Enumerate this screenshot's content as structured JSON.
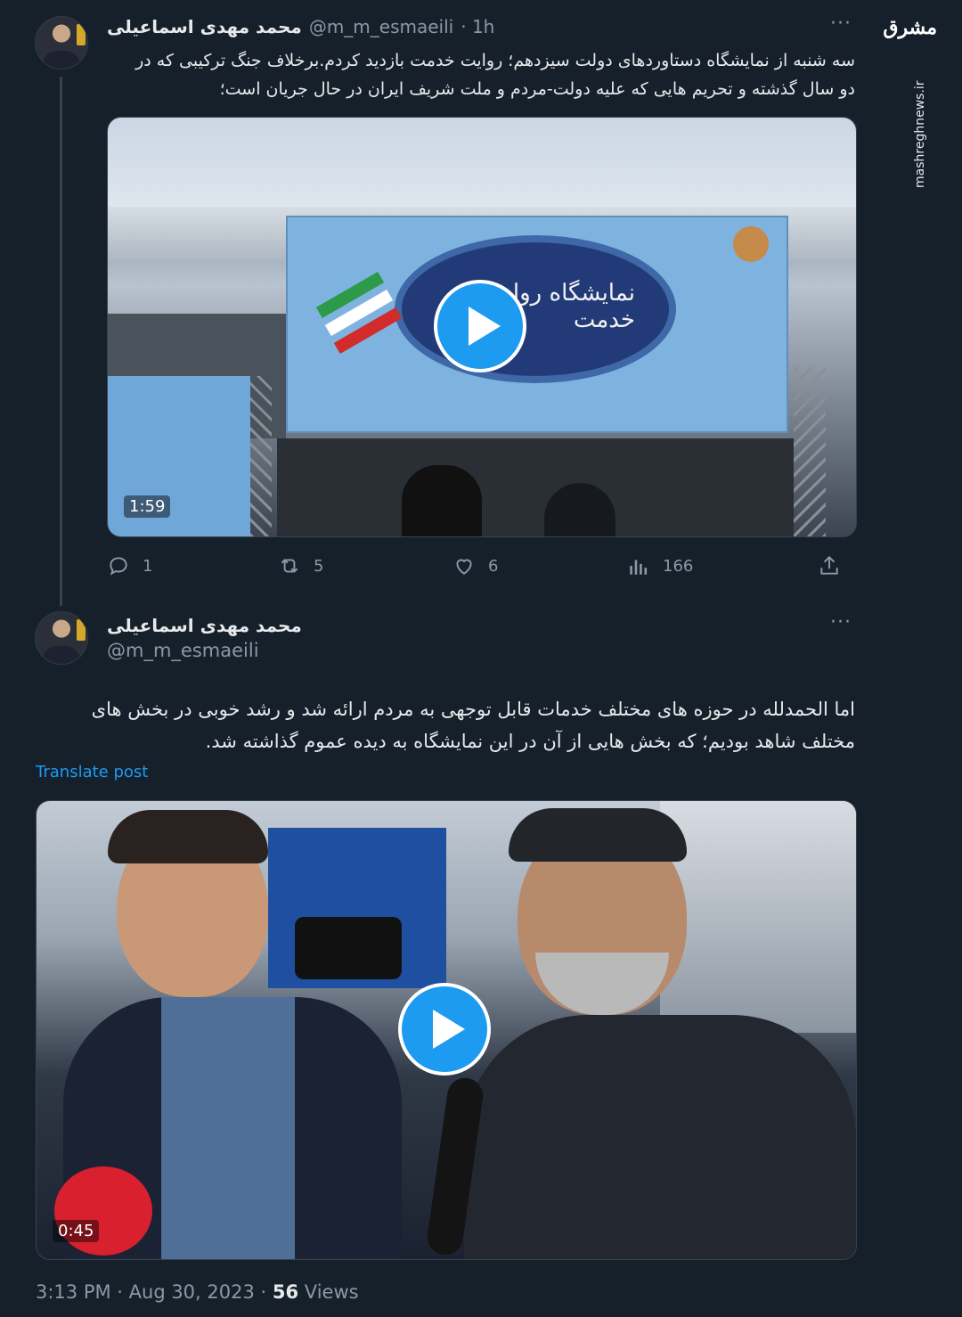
{
  "watermark": {
    "logo_text": "مشرق",
    "site": "mashreghnews.ir"
  },
  "tweet1": {
    "author_name": "محمد مهدی اسماعیلی",
    "handle": "@m_m_esmaeili",
    "time": "· 1h",
    "more": "···",
    "text_line1": "سه شنبه از نمایشگاه دستاوردهای دولت سیزدهم؛ روایت خدمت بازدید کردم.برخلاف جنگ ترکیبی که در",
    "text_line2": "دو سال گذشته و تحریم هایی که علیه دولت-مردم و ملت شریف ایران در حال جریان است؛",
    "video_duration": "1:59",
    "banner_text": "نمایشگاه روایت خدمت",
    "replies": "1",
    "reposts": "5",
    "likes": "6",
    "views": "166"
  },
  "tweet2": {
    "author_name": "محمد مهدی اسماعیلی",
    "handle": "@m_m_esmaeili",
    "more": "···",
    "text_line1": "اما الحمدلله در حوزه های مختلف خدمات قابل توجهی به مردم ارائه شد و رشد خوبی در بخش های",
    "text_line2": "مختلف شاهد بودیم؛ که بخش هایی از آن در این نمایشگاه به دیده عموم گذاشته شد.",
    "translate": "Translate post",
    "video_duration": "0:45",
    "footer_time": "3:13 PM · Aug 30, 2023 · ",
    "footer_views_count": "56",
    "footer_views_label": " Views"
  },
  "colors": {
    "background": "#15202b",
    "accent": "#1d9bf0",
    "muted": "#8b98a5",
    "text": "#e7e9ea"
  }
}
